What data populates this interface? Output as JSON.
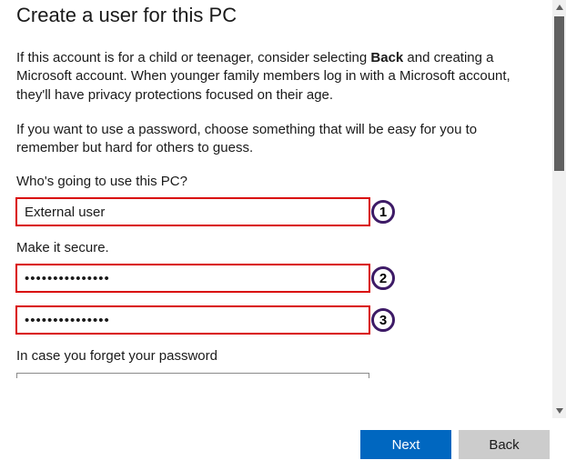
{
  "title": "Create a user for this PC",
  "intro_para": {
    "pre": "If this account is for a child or teenager, consider selecting ",
    "bold": "Back",
    "post": " and creating a Microsoft account. When younger family members log in with a Microsoft account, they'll have privacy protections focused on their age."
  },
  "password_hint_para": "If you want to use a password, choose something that will be easy for you to remember but hard for others to guess.",
  "who_label": "Who's going to use this PC?",
  "username_field": {
    "value": "External user"
  },
  "secure_label": "Make it secure.",
  "password_field": {
    "masked": "•••••••••••••••"
  },
  "confirm_field": {
    "masked": "•••••••••••••••"
  },
  "forget_label": "In case you forget your password",
  "callouts": {
    "c1": "1",
    "c2": "2",
    "c3": "3"
  },
  "buttons": {
    "next": "Next",
    "back": "Back"
  }
}
